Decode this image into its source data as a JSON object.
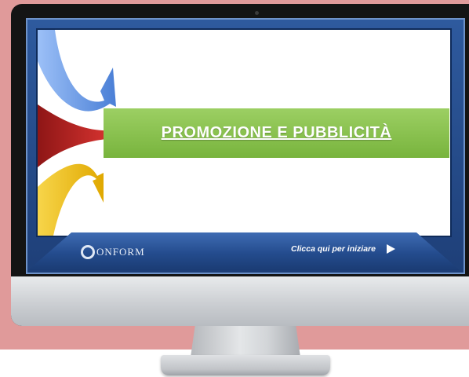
{
  "slide": {
    "title": "PROMOZIONE E PUBBLICITÀ"
  },
  "player": {
    "logo_text": "ONFORM",
    "cta_label": "Clicca qui per iniziare",
    "cta_icon": "play-icon"
  },
  "colors": {
    "background_pink": "#e09a9a",
    "frame_blue": "#244c8e",
    "title_green": "#8bc34a",
    "arrow_blue": "#5b8fe0",
    "arrow_red": "#d32f2f",
    "arrow_yellow": "#f5c518"
  }
}
